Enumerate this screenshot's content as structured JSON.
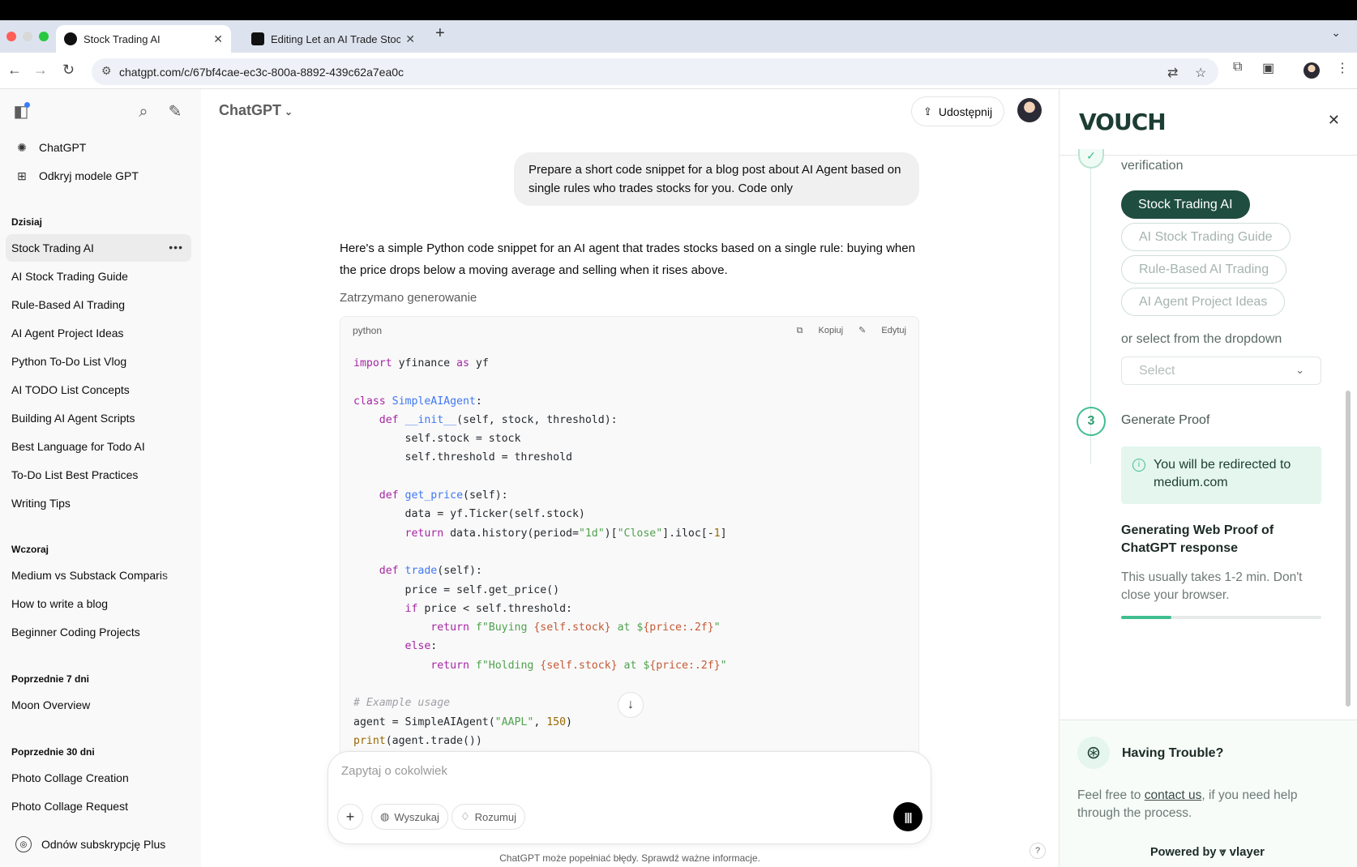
{
  "browser": {
    "tabs": [
      {
        "title": "Stock Trading AI",
        "active": true
      },
      {
        "title": "Editing Let an AI Trade Stock",
        "active": false
      }
    ],
    "url": "chatgpt.com/c/67bf4cae-ec3c-800a-8892-439c62a7ea0c",
    "traffic_colors": [
      "#ff5f57",
      "#d8d8d8",
      "#28c840"
    ]
  },
  "sidebar": {
    "nav": [
      {
        "label": "ChatGPT",
        "icon": "openai-logo-icon"
      },
      {
        "label": "Odkryj modele GPT",
        "icon": "grid-icon"
      }
    ],
    "groups": [
      {
        "title": "Dzisiaj",
        "items": [
          "Stock Trading AI",
          "AI Stock Trading Guide",
          "Rule-Based AI Trading",
          "AI Agent Project Ideas",
          "Python To-Do List Vlog",
          "AI TODO List Concepts",
          "Building AI Agent Scripts",
          "Best Language for Todo AI",
          "To-Do List Best Practices",
          "Writing Tips"
        ]
      },
      {
        "title": "Wczoraj",
        "items": [
          "Medium vs Substack Comparis",
          "How to write a blog",
          "Beginner Coding Projects"
        ]
      },
      {
        "title": "Poprzednie 7 dni",
        "items": [
          "Moon Overview"
        ]
      },
      {
        "title": "Poprzednie 30 dni",
        "items": [
          "Photo Collage Creation",
          "Photo Collage Request"
        ]
      }
    ],
    "item_menu": "•••",
    "upgrade": "Odnów subskrypcję Plus"
  },
  "header": {
    "model": "ChatGPT",
    "share": "Udostępnij"
  },
  "chat": {
    "user_message": "Prepare a short code snippet for a blog post about AI Agent based on single rules who trades stocks for you. Code only",
    "assistant_text": "Here's a simple Python code snippet for an AI agent that trades stocks based on a single rule: buying when the price drops below a moving average and selling when it rises above.",
    "stopped": "Zatrzymano generowanie",
    "code_lang": "python",
    "copy_label": "Kopiuj",
    "edit_label": "Edytuj"
  },
  "composer": {
    "placeholder": "Zapytaj o cokolwiek",
    "search": "Wyszukaj",
    "reason": "Rozumuj",
    "disclaimer": "ChatGPT może popełniać błędy. Sprawdź ważne informacje.",
    "help": "?"
  },
  "vouch": {
    "logo": "VOUCH",
    "verification": "verification",
    "chips": [
      {
        "label": "Stock Trading AI",
        "selected": true
      },
      {
        "label": "AI Stock Trading Guide",
        "selected": false
      },
      {
        "label": "Rule-Based AI Trading",
        "selected": false
      },
      {
        "label": "AI Agent Project Ideas",
        "selected": false
      }
    ],
    "dropdown_hint": "or select from the dropdown",
    "select_placeholder": "Select",
    "step_number": "3",
    "step_title": "Generate Proof",
    "redirect_note": "You will be redirected to medium.com",
    "generating_title": "Generating Web Proof of ChatGPT response",
    "generating_sub": "This usually takes 1-2 min. Don't close your browser.",
    "progress": 0.25,
    "trouble_title": "Having Trouble?",
    "trouble_pre": "Feel free to ",
    "trouble_link": "contact us",
    "trouble_post": ", if you need help through the process.",
    "powered_by": "Powered by",
    "brand": "vlayer",
    "accent": "#3fbf8f",
    "dark": "#1f4d3f"
  }
}
